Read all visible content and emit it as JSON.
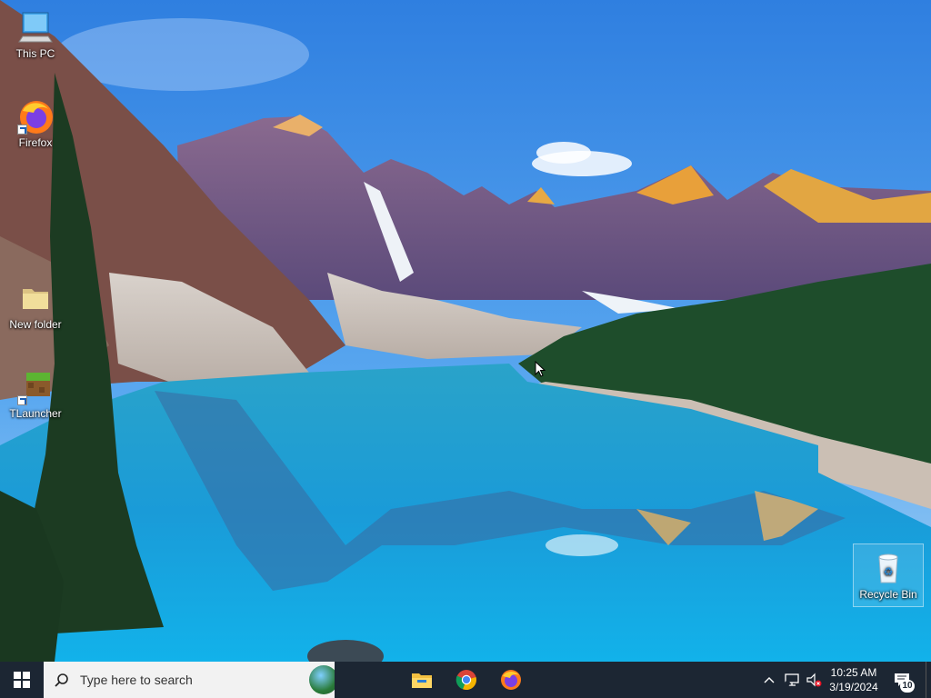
{
  "desktop": {
    "icons": [
      {
        "label": "This PC",
        "icon": "this-pc-icon"
      },
      {
        "label": "Firefox",
        "icon": "firefox-icon"
      },
      {
        "label": "New folder",
        "icon": "folder-icon"
      },
      {
        "label": "TLauncher",
        "icon": "tlauncher-icon"
      },
      {
        "label": "Recycle Bin",
        "icon": "recycle-bin-icon"
      }
    ]
  },
  "taskbar": {
    "search_placeholder": "Type here to search",
    "pinned": [
      {
        "name": "File Explorer",
        "icon": "file-explorer-icon"
      },
      {
        "name": "Google Chrome",
        "icon": "chrome-icon"
      },
      {
        "name": "Firefox",
        "icon": "firefox-icon"
      }
    ],
    "clock": {
      "time": "10:25 AM",
      "date": "3/19/2024"
    },
    "notifications_count": "10"
  },
  "colors": {
    "taskbar": "#1c2633",
    "sky_top": "#2f7fe0",
    "lake": "#1fa6d6",
    "forest": "#1e4d2b"
  }
}
